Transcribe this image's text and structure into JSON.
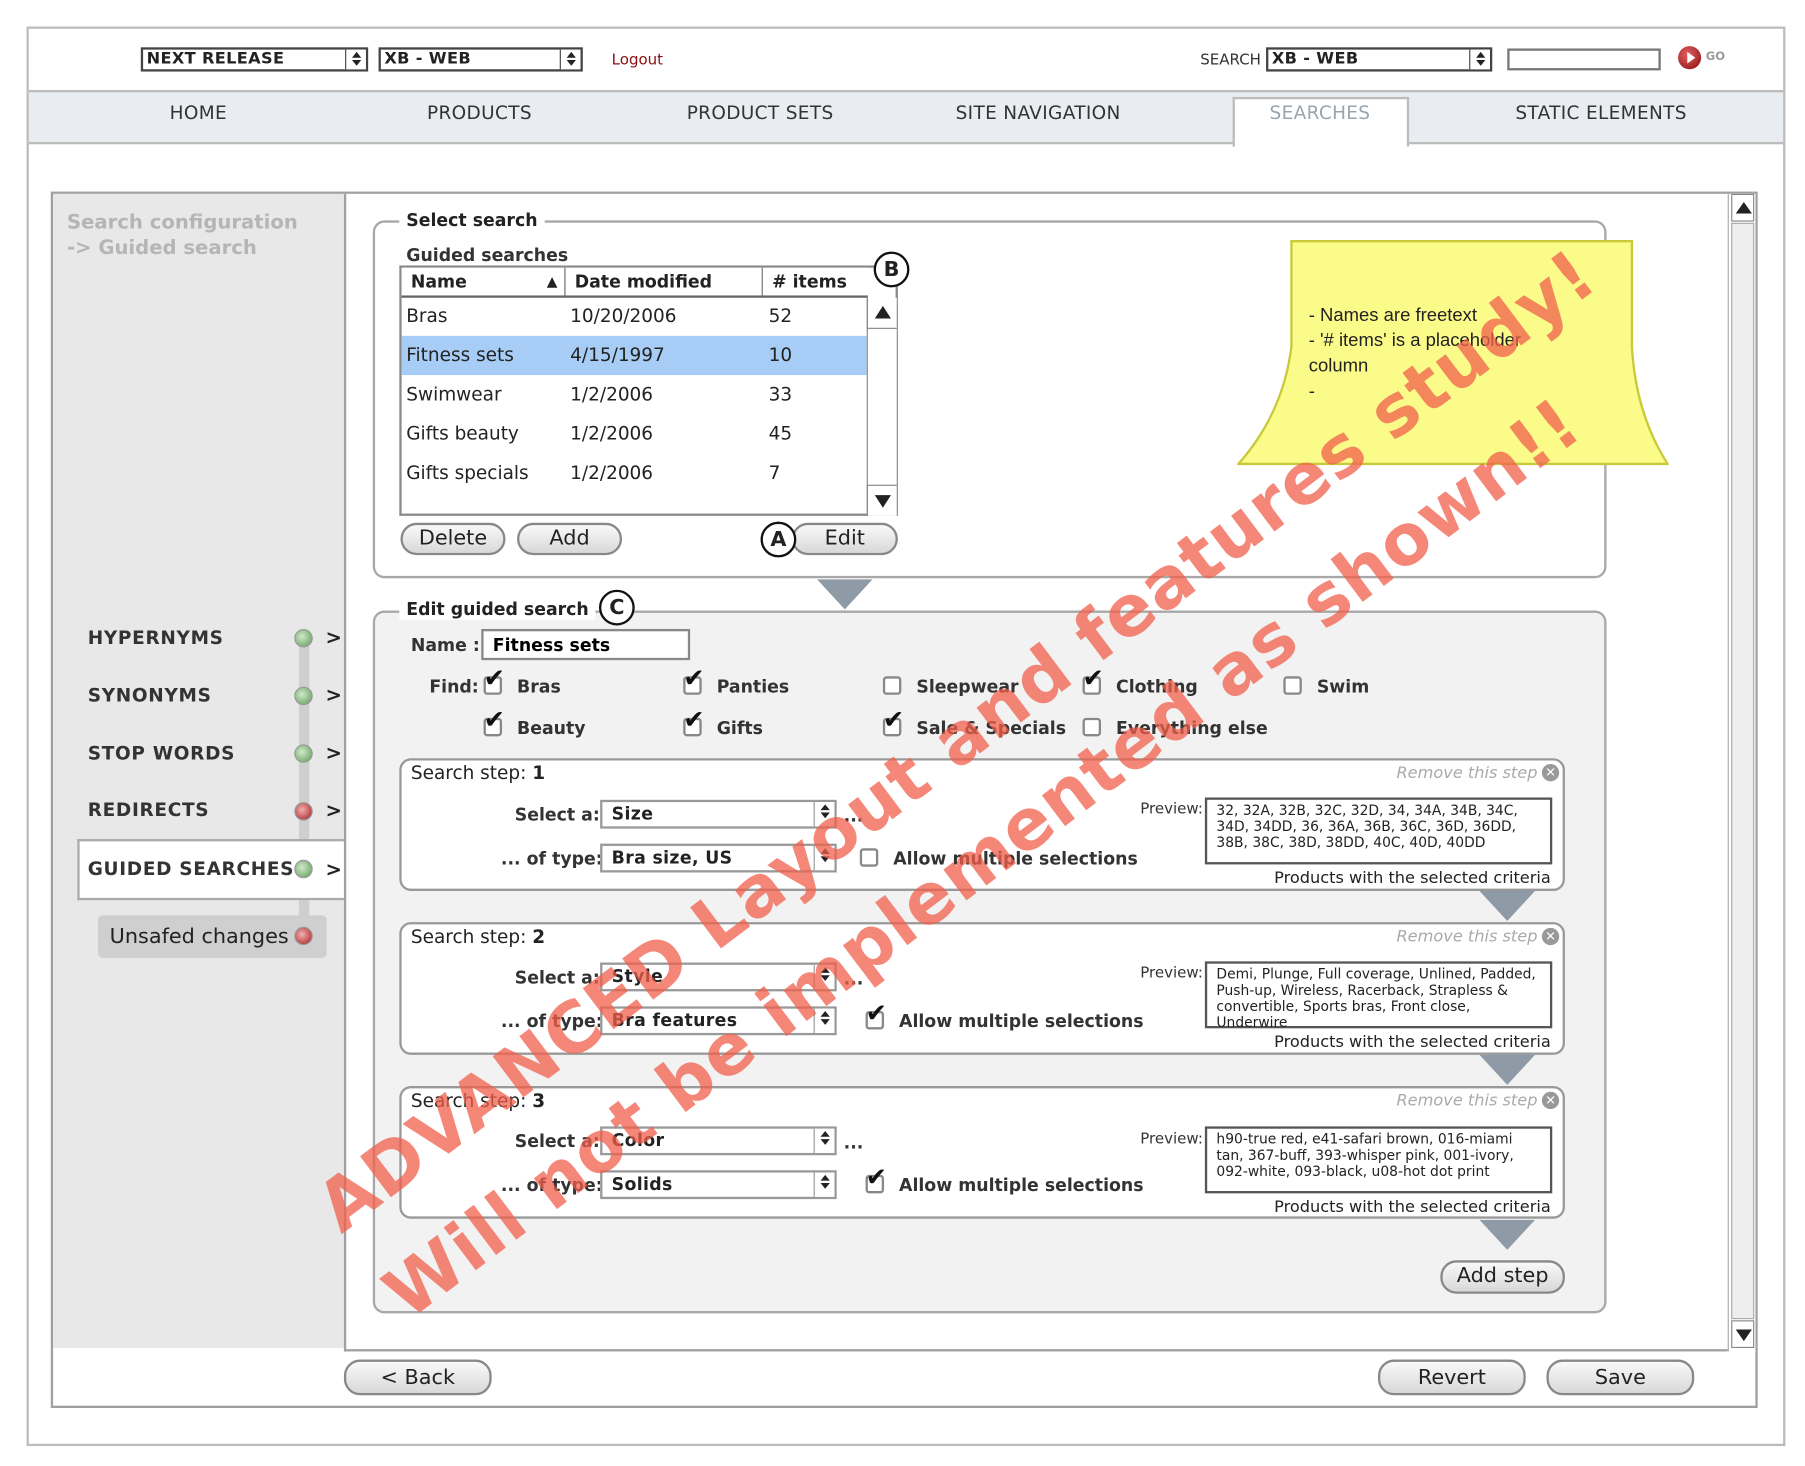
{
  "header": {
    "release_select": "NEXT RELEASE",
    "site_select": "XB - WEB",
    "logout": "Logout",
    "search_label": "SEARCH",
    "search_select": "XB - WEB",
    "search_input": "",
    "go_label": "GO"
  },
  "nav": {
    "items": [
      "HOME",
      "PRODUCTS",
      "PRODUCT SETS",
      "SITE NAVIGATION",
      "SEARCHES",
      "STATIC ELEMENTS"
    ],
    "active": "SEARCHES"
  },
  "breadcrumb": {
    "line1": "Search configuration",
    "line2": "-> Guided search"
  },
  "sidebar": {
    "items": [
      {
        "label": "HYPERNYMS",
        "status": "green"
      },
      {
        "label": "SYNONYMS",
        "status": "green"
      },
      {
        "label": "STOP WORDS",
        "status": "green"
      },
      {
        "label": "REDIRECTS",
        "status": "red"
      },
      {
        "label": "GUIDED SEARCHES",
        "status": "green"
      }
    ],
    "chevron": ">",
    "unsaved": "Unsafed changes"
  },
  "select_search": {
    "legend": "Select search",
    "list_title": "Guided searches",
    "columns": [
      "Name",
      "Date modified",
      "# items"
    ],
    "rows": [
      [
        "Bras",
        "10/20/2006",
        "52"
      ],
      [
        "Fitness sets",
        "4/15/1997",
        "10"
      ],
      [
        "Swimwear",
        "1/2/2006",
        "33"
      ],
      [
        "Gifts beauty",
        "1/2/2006",
        "45"
      ],
      [
        "Gifts specials",
        "1/2/2006",
        "7"
      ]
    ],
    "selected_row": 1,
    "delete": "Delete",
    "add": "Add",
    "edit": "Edit"
  },
  "markers": {
    "a": "A",
    "b": "B",
    "c": "C"
  },
  "note": {
    "lines": [
      "- Names are freetext",
      "- '# items' is a placeholder",
      "column",
      "-"
    ]
  },
  "edit": {
    "legend": "Edit guided search",
    "name_label": "Name :",
    "name_value": "Fitness sets",
    "find_label": "Find:",
    "checks": [
      {
        "label": "Bras",
        "checked": true
      },
      {
        "label": "Panties",
        "checked": true
      },
      {
        "label": "Sleepwear",
        "checked": false
      },
      {
        "label": "Clothing",
        "checked": true
      },
      {
        "label": "Swim",
        "checked": false
      },
      {
        "label": "Beauty",
        "checked": true
      },
      {
        "label": "Gifts",
        "checked": true
      },
      {
        "label": "Sale & Specials",
        "checked": true
      },
      {
        "label": "Everything else",
        "checked": false
      }
    ]
  },
  "steps": [
    {
      "title": "Search step:",
      "num": "1",
      "remove": "Remove this step",
      "select_label": "Select a:",
      "select_value": "Size",
      "type_label": "... of type:",
      "type_value": "Bra size, US",
      "ellipsis": "...",
      "multi_label": "Allow multiple selections",
      "multi": false,
      "preview_label": "Preview:",
      "preview": "32, 32A, 32B, 32C, 32D, 34, 34A, 34B, 34C, 34D, 34DD, 36, 36A, 36B, 36C, 36D, 36DD, 38B, 38C, 38D, 38DD, 40C, 40D, 40DD",
      "criteria": "Products with the selected criteria"
    },
    {
      "title": "Search step:",
      "num": "2",
      "remove": "Remove this step",
      "select_label": "Select a:",
      "select_value": "Style",
      "type_label": "... of type:",
      "type_value": "Bra features",
      "ellipsis": "...",
      "multi_label": "Allow multiple selections",
      "multi": true,
      "preview_label": "Preview:",
      "preview": "Demi, Plunge, Full coverage, Unlined, Padded, Push-up, Wireless, Racerback, Strapless & convertible, Sports bras, Front close, Underwire",
      "criteria": "Products with the selected criteria"
    },
    {
      "title": "Search step:",
      "num": "3",
      "remove": "Remove this step",
      "select_label": "Select a:",
      "select_value": "Color",
      "type_label": "... of type:",
      "type_value": "Solids",
      "ellipsis": "...",
      "multi_label": "Allow multiple selections",
      "multi": true,
      "preview_label": "Preview:",
      "preview": "h90-true red, e41-safari brown, 016-miami tan, 367-buff, 393-whisper pink, 001-ivory, 092-white, 093-black, u08-hot dot print",
      "criteria": "Products with the selected criteria"
    }
  ],
  "add_step": "Add step",
  "footer": {
    "back": "< Back",
    "revert": "Revert",
    "save": "Save"
  },
  "watermark": {
    "line1": "ADVANCED Layout and features study!",
    "line2": "Will not be implemented as shown!!"
  },
  "colors": {
    "selected_row": "#a7cdf6",
    "note_bg": "#fbfb8a",
    "watermark": "#f05f4b",
    "nav_bg": "#e9ecf1"
  }
}
